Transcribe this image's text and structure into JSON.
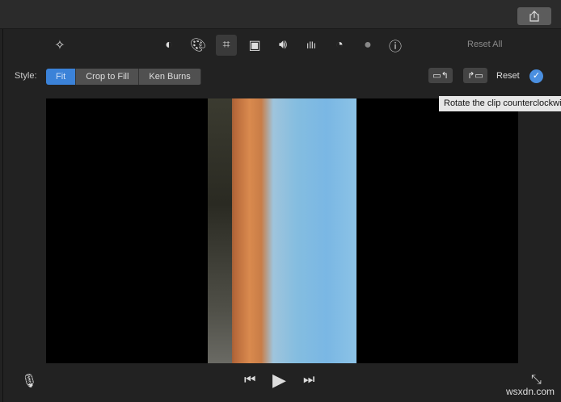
{
  "toolbar": {
    "reset_all": "Reset All",
    "icons": [
      "magic-wand-icon",
      "color-balance-icon",
      "color-palette-icon",
      "crop-icon",
      "stabilization-icon",
      "volume-icon",
      "equalizer-icon",
      "speed-icon",
      "filter-icon",
      "info-icon"
    ]
  },
  "style": {
    "label": "Style:",
    "options": [
      "Fit",
      "Crop to Fill",
      "Ken Burns"
    ],
    "selected": "Fit"
  },
  "actions": {
    "reset": "Reset",
    "tooltip": "Rotate the clip counterclockwise"
  },
  "watermark": "wsxdn.com",
  "colors": {
    "accent": "#3b82d8",
    "background": "#222222"
  }
}
